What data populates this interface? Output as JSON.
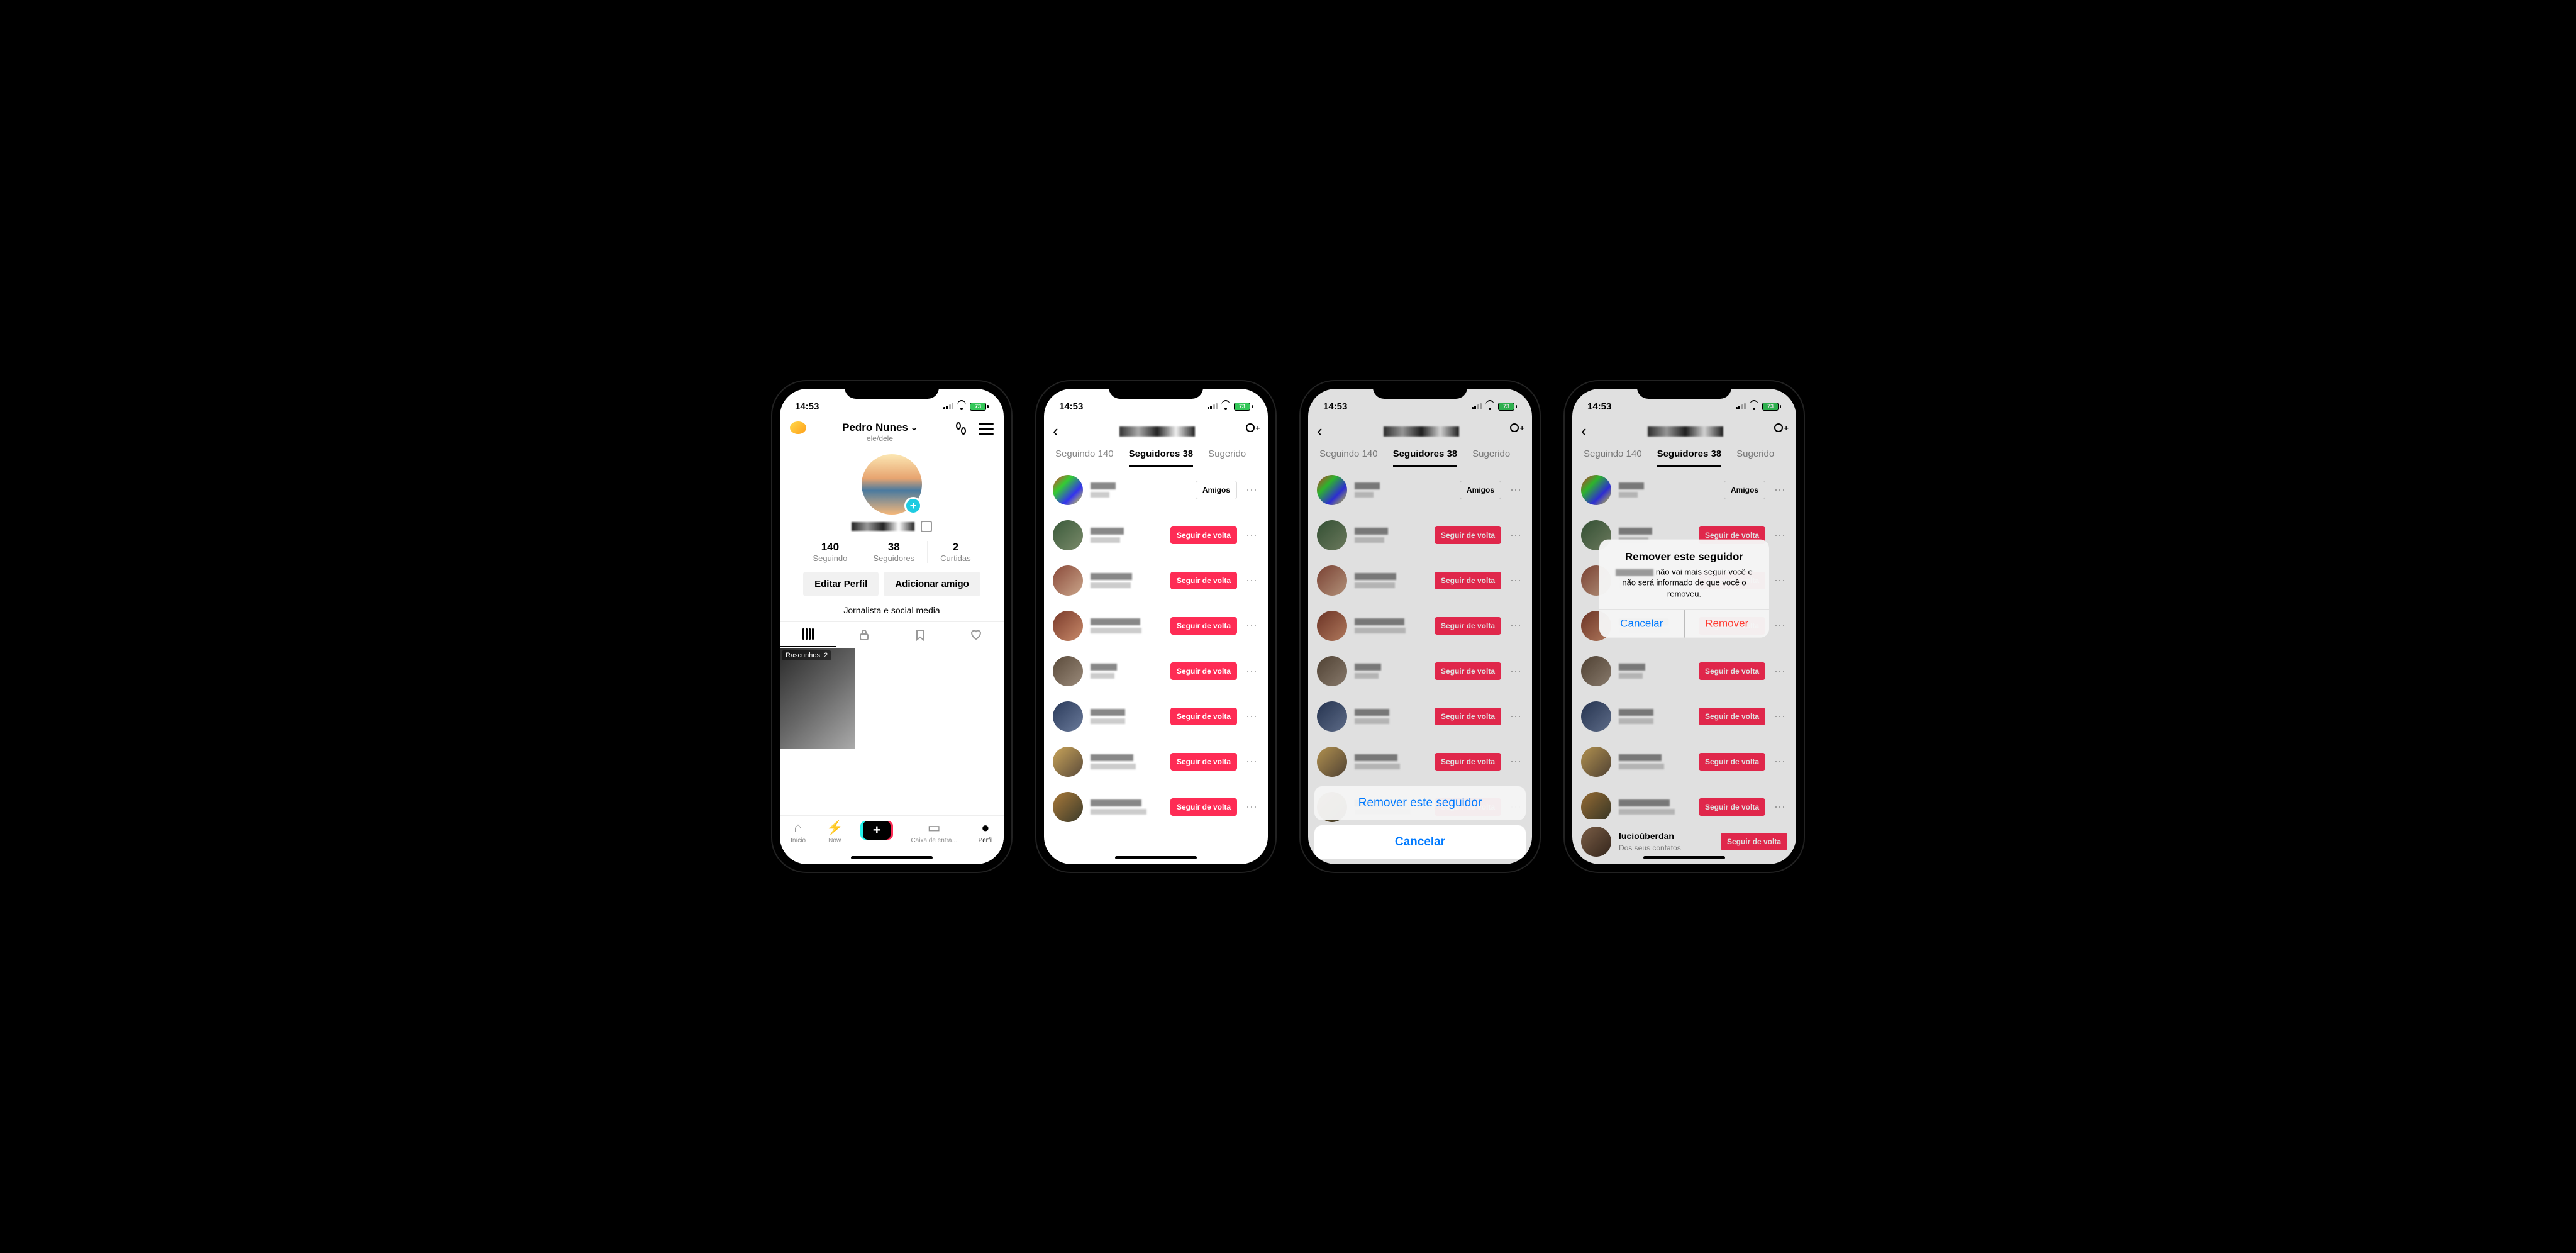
{
  "status": {
    "time": "14:53",
    "battery": "73"
  },
  "profile": {
    "name": "Pedro Nunes",
    "pronoun": "ele/dele",
    "stats": {
      "following_n": "140",
      "following_l": "Seguindo",
      "followers_n": "38",
      "followers_l": "Seguidores",
      "likes_n": "2",
      "likes_l": "Curtidas"
    },
    "edit_btn": "Editar Perfil",
    "add_friend_btn": "Adicionar amigo",
    "bio": "Jornalista e social media",
    "drafts_label": "Rascunhos: 2"
  },
  "nav": {
    "home": "Início",
    "now": "Now",
    "inbox": "Caixa de entra...",
    "profile": "Perfil"
  },
  "tabs": {
    "following": "Seguindo 140",
    "followers": "Seguidores 38",
    "suggested": "Sugerido"
  },
  "buttons": {
    "friends": "Amigos",
    "follow_back": "Seguir de volta"
  },
  "followers": [
    {
      "btn": "friends",
      "av": "linear-gradient(135deg,#e33,#3c3,#33e,#ee3)"
    },
    {
      "btn": "follow",
      "av": "linear-gradient(135deg,#3a5a3a,#7a8a6a)"
    },
    {
      "btn": "follow",
      "av": "linear-gradient(135deg,#8a4a3a,#caa58a)"
    },
    {
      "btn": "follow",
      "av": "linear-gradient(135deg,#7a3a2a,#c88a6a)"
    },
    {
      "btn": "follow",
      "av": "linear-gradient(135deg,#5a4a3a,#9a8a7a)"
    },
    {
      "btn": "follow",
      "av": "linear-gradient(135deg,#2a3a5a,#6a7a9a)"
    },
    {
      "btn": "follow",
      "av": "linear-gradient(135deg,#caa55a,#5a4a3a)"
    },
    {
      "btn": "follow",
      "av": "linear-gradient(135deg,#aa7a3a,#3a3a2a)"
    }
  ],
  "last_follower": {
    "name": "lucioúberdan",
    "sub": "Dos seus contatos"
  },
  "action_sheet": {
    "remove": "Remover este seguidor",
    "cancel": "Cancelar"
  },
  "alert": {
    "title": "Remover este seguidor",
    "msg_suffix": " não vai mais seguir você e não será informado de que você o removeu.",
    "cancel": "Cancelar",
    "remove": "Remover"
  }
}
